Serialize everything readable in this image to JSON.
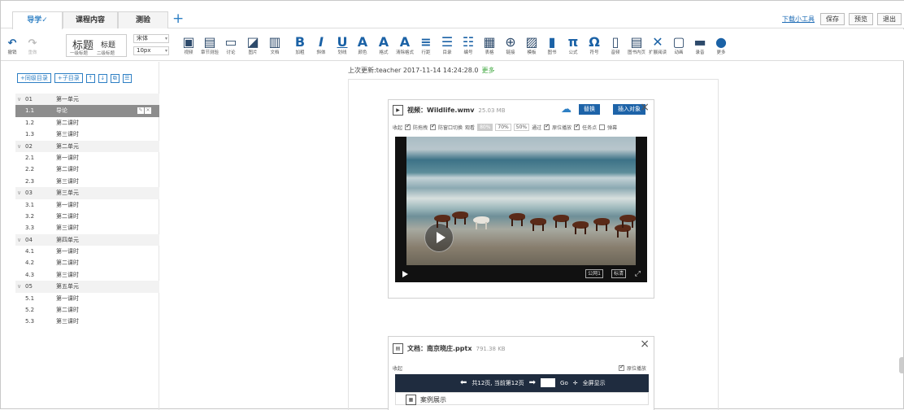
{
  "tabs": [
    {
      "label": "导学✓",
      "active": true
    },
    {
      "label": "课程内容",
      "active": false
    },
    {
      "label": "测验",
      "active": false
    }
  ],
  "top_links": {
    "download": "下载小工具",
    "save": "保存",
    "preview": "预览",
    "exit": "退出"
  },
  "toolbar": {
    "undo": "撤销",
    "redo": "重做",
    "heading": {
      "h1": "标题",
      "h2": "标题",
      "h1_sub": "一级标题",
      "h2_sub": "二级标题"
    },
    "font": "宋体",
    "font_size": "10px",
    "tools": [
      {
        "icon": "▣",
        "label": "视频"
      },
      {
        "icon": "▤",
        "label": "章节测验"
      },
      {
        "icon": "▭",
        "label": "讨论"
      },
      {
        "icon": "◪",
        "label": "图片"
      },
      {
        "icon": "▥",
        "label": "文档"
      },
      {
        "icon": "B",
        "label": "加粗"
      },
      {
        "icon": "I",
        "label": "斜体"
      },
      {
        "icon": "U",
        "label": "划线"
      },
      {
        "icon": "A",
        "label": "颜色"
      },
      {
        "icon": "A",
        "label": "格式"
      },
      {
        "icon": "A",
        "label": "清除格式"
      },
      {
        "icon": "≡",
        "label": "行距"
      },
      {
        "icon": "☰",
        "label": "目录"
      },
      {
        "icon": "☷",
        "label": "编号"
      },
      {
        "icon": "▦",
        "label": "表格"
      },
      {
        "icon": "⊕",
        "label": "链接"
      },
      {
        "icon": "▨",
        "label": "模板"
      },
      {
        "icon": "▮",
        "label": "图书"
      },
      {
        "icon": "π",
        "label": "公式"
      },
      {
        "icon": "Ω",
        "label": "符号"
      },
      {
        "icon": "▯",
        "label": "音频"
      },
      {
        "icon": "▤",
        "label": "图书内页"
      },
      {
        "icon": "✕",
        "label": "扩展阅读"
      },
      {
        "icon": "▢",
        "label": "动画"
      },
      {
        "icon": "▬",
        "label": "录音"
      },
      {
        "icon": "●",
        "label": "更多"
      }
    ]
  },
  "sidebar": {
    "add_chapter": "+同级目录",
    "add_sub": "+子目录",
    "outline": [
      {
        "num": "01",
        "title": "第一单元",
        "unit": true
      },
      {
        "num": "1.1",
        "title": "导论",
        "selected": true
      },
      {
        "num": "1.2",
        "title": "第二课时"
      },
      {
        "num": "1.3",
        "title": "第三课时"
      },
      {
        "num": "02",
        "title": "第二单元",
        "unit": true
      },
      {
        "num": "2.1",
        "title": "第一课时"
      },
      {
        "num": "2.2",
        "title": "第二课时"
      },
      {
        "num": "2.3",
        "title": "第三课时"
      },
      {
        "num": "03",
        "title": "第三单元",
        "unit": true
      },
      {
        "num": "3.1",
        "title": "第一课时"
      },
      {
        "num": "3.2",
        "title": "第二课时"
      },
      {
        "num": "3.3",
        "title": "第三课时"
      },
      {
        "num": "04",
        "title": "第四单元",
        "unit": true
      },
      {
        "num": "4.1",
        "title": "第一课时"
      },
      {
        "num": "4.2",
        "title": "第二课时"
      },
      {
        "num": "4.3",
        "title": "第三课时"
      },
      {
        "num": "05",
        "title": "第五单元",
        "unit": true
      },
      {
        "num": "5.1",
        "title": "第一课时"
      },
      {
        "num": "5.2",
        "title": "第二课时"
      },
      {
        "num": "5.3",
        "title": "第三课时"
      }
    ]
  },
  "main": {
    "last_update": "上次更新:teacher 2017-11-14 14:24:28.0",
    "more": "更多",
    "video_card": {
      "title": "视频：Wildlife.wmv",
      "size": "25.03 MB",
      "replace": "替换",
      "insert": "插入对象",
      "options": {
        "collapse": "收起",
        "anti_drag": "防拖拽",
        "anti_switch": "防窗口切换",
        "observe": "观看",
        "percents": [
          "80%",
          "70%",
          "50%"
        ],
        "pass": "通过",
        "original_play": "原位播放",
        "task_point": "任务点",
        "bullet": "弹幕"
      },
      "tags": {
        "public": "公网1",
        "quality": "标清"
      }
    },
    "doc_card": {
      "title": "文档：南京晓庄.pptx",
      "size": "791.38 KB",
      "collapse": "收起",
      "original_play": "原位播放",
      "nav": "共12页, 当前第12页",
      "go": "Go",
      "fullscreen": "全屏显示",
      "slide_title": "案例展示"
    }
  }
}
